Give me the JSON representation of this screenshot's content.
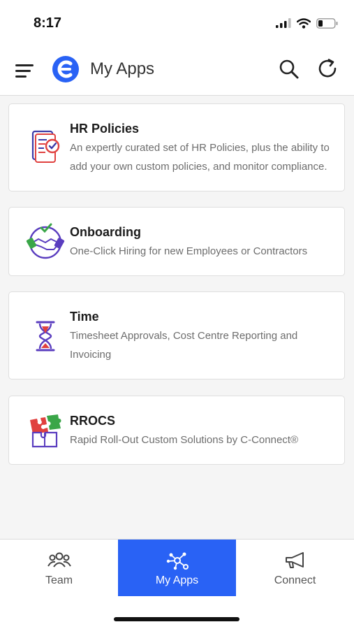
{
  "status_bar": {
    "time": "8:17"
  },
  "header": {
    "title": "My Apps"
  },
  "apps": [
    {
      "title": "HR Policies",
      "description": "An expertly curated set of HR Policies, plus the ability to add your own custom policies, and monitor compliance.",
      "icon": "hr-policies-icon"
    },
    {
      "title": "Onboarding",
      "description": "One-Click Hiring for new Employees or Contractors",
      "icon": "onboarding-handshake-icon"
    },
    {
      "title": "Time",
      "description": "Timesheet Approvals, Cost Centre Reporting and Invoicing",
      "icon": "hourglass-icon"
    },
    {
      "title": "RROCS",
      "description": "Rapid Roll-Out Custom Solutions by C-Connect®",
      "icon": "puzzle-icon"
    }
  ],
  "tabs": [
    {
      "label": "Team",
      "icon": "team-icon",
      "active": false
    },
    {
      "label": "My Apps",
      "icon": "network-icon",
      "active": true
    },
    {
      "label": "Connect",
      "icon": "megaphone-icon",
      "active": false
    }
  ],
  "colors": {
    "accent": "#2962f5",
    "card_border": "#dedede",
    "background": "#f5f5f5"
  }
}
